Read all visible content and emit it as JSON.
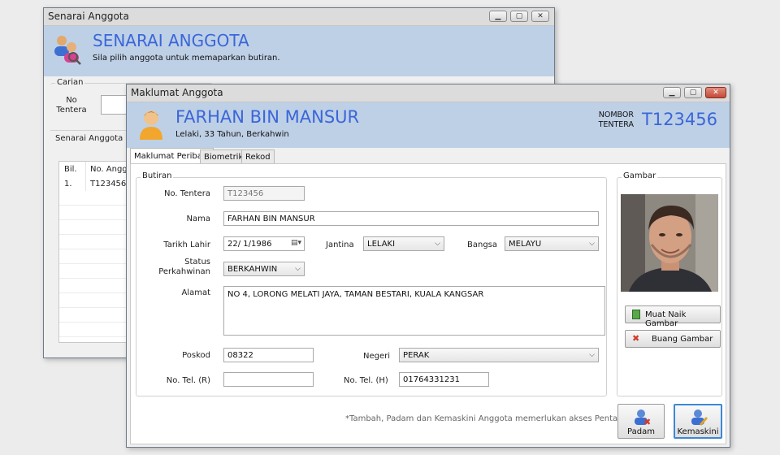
{
  "back_window": {
    "title": "Senarai Anggota",
    "header_title": "SENARAI ANGGOTA",
    "header_subtitle": "Sila pilih anggota untuk memaparkan butiran.",
    "search_group": "Carian",
    "no_tentera_label": "No\nTentera",
    "list_group": "Senarai Anggota",
    "columns": [
      "Bil.",
      "No. Angg"
    ],
    "rows": [
      [
        "1.",
        "T123456"
      ]
    ]
  },
  "front_window": {
    "title": "Maklumat Anggota",
    "member_name": "FARHAN BIN MANSUR",
    "member_summary": "Lelaki, 33 Tahun, Berkahwin",
    "nombor_tentera_label": "NOMBOR\nTENTERA",
    "nombor_tentera_value": "T123456",
    "tabs": [
      "Maklumat Peribadi",
      "Biometrik",
      "Rekod"
    ],
    "butiran_group": "Butiran",
    "fields": {
      "no_tentera": {
        "label": "No. Tentera",
        "value": "T123456"
      },
      "nama": {
        "label": "Nama",
        "value": "FARHAN BIN MANSUR"
      },
      "tarikh_lahir": {
        "label": "Tarikh Lahir",
        "value": "22/  1/1986"
      },
      "jantina": {
        "label": "Jantina",
        "value": "LELAKI"
      },
      "bangsa": {
        "label": "Bangsa",
        "value": "MELAYU"
      },
      "status": {
        "label": "Status\nPerkahwinan",
        "value": "BERKAHWIN"
      },
      "alamat": {
        "label": "Alamat",
        "value": "NO 4, LORONG MELATI JAYA, TAMAN BESTARI, KUALA KANGSAR"
      },
      "poskod": {
        "label": "Poskod",
        "value": "08322"
      },
      "negeri": {
        "label": "Negeri",
        "value": "PERAK"
      },
      "tel_r": {
        "label": "No. Tel. (R)",
        "value": ""
      },
      "tel_h": {
        "label": "No. Tel. (H)",
        "value": "01764331231"
      }
    },
    "gambar_group": "Gambar",
    "upload_button": "Muat Naik Gambar",
    "remove_button": "Buang Gambar",
    "note": "*Tambah, Padam dan Kemaskini Anggota memerlukan akses Pentadbir",
    "delete_button": "Padam",
    "update_button": "Kemaskini"
  },
  "colors": {
    "header_bg": "#bed0e6",
    "accent_title": "#3a66d8",
    "window_bg": "#f0f0f0"
  }
}
